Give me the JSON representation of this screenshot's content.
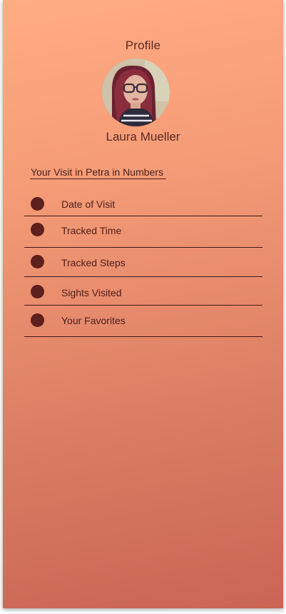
{
  "header": {
    "title": "Profile"
  },
  "user": {
    "name": "Laura Mueller",
    "avatar_icon": "user-avatar-photo"
  },
  "stats_section": {
    "title": "Your Visit in Petra in Numbers",
    "items": [
      {
        "label": "Date of Visit",
        "icon": "bullet-dot-icon"
      },
      {
        "label": "Tracked Time",
        "icon": "bullet-dot-icon"
      },
      {
        "label": "Tracked Steps",
        "icon": "bullet-dot-icon"
      },
      {
        "label": "Sights Visited",
        "icon": "bullet-dot-icon"
      },
      {
        "label": "Your Favorites",
        "icon": "bullet-dot-icon"
      }
    ]
  },
  "colors": {
    "gradient_top": "#ffac84",
    "gradient_bottom": "#c96554",
    "dot": "#5e201c",
    "text": "#4a1f1c"
  }
}
